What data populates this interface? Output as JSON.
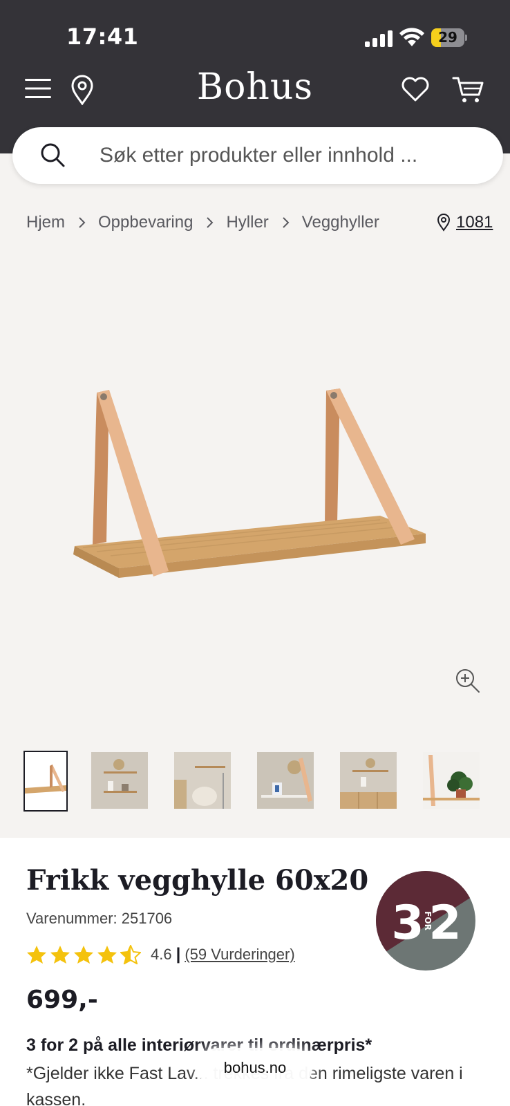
{
  "status_bar": {
    "time": "17:41",
    "battery": "29",
    "battery_level": 0.29
  },
  "header": {
    "logo": "Bohus",
    "icons": [
      "menu-icon",
      "location-pin-icon",
      "heart-icon",
      "cart-icon"
    ]
  },
  "search": {
    "placeholder": "Søk etter produkter eller innhold ..."
  },
  "breadcrumb": {
    "items": [
      "Hjem",
      "Oppbevaring",
      "Hyller",
      "Vegghyller"
    ],
    "store": "1081"
  },
  "gallery": {
    "thumbnail_count": 6,
    "selected_index": 0
  },
  "product": {
    "title": "Frikk vegghylle 60x20",
    "sku": "Varenummer: 251706",
    "rating_value": "4.6",
    "rating_fraction": 0.92,
    "rating_separator": "|",
    "rating_count": "(59 Vurderinger)",
    "price": "699,-",
    "badge": {
      "left": "3",
      "middle": "FOR",
      "right": "2"
    },
    "promo_title": "3 for 2 på alle interiørvarer til ordinærpris*",
    "promo_text": "*Gjelder ikke Fast Lav... trekkes fra den rimeligste varen i kassen."
  },
  "browser": {
    "url": "bohus.no"
  },
  "colors": {
    "header_bg": "#343338",
    "star": "#f4c20d",
    "badge_top": "#5c2a36",
    "badge_bottom": "#6d7674",
    "battery": "#f5cf1c"
  }
}
